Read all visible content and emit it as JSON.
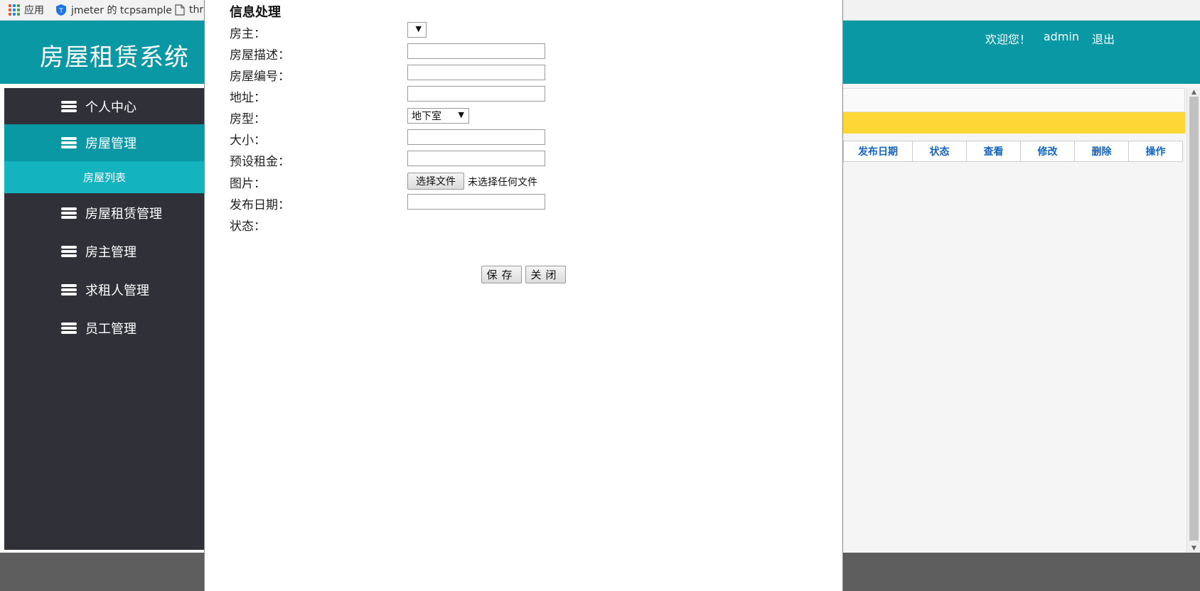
{
  "bookmarks": [
    {
      "label": "应用",
      "icon": "apps-icon"
    },
    {
      "label": "jmeter 的 tcpsample",
      "icon": "shield-icon"
    },
    {
      "label": "thr",
      "icon": "page-icon"
    }
  ],
  "header": {
    "title": "房屋租赁系统",
    "welcome": "欢迎您！",
    "username": "admin",
    "logout": "退出"
  },
  "sidebar": {
    "items": [
      {
        "label": "个人中心",
        "icon": "stack-icon"
      },
      {
        "label": "房屋管理",
        "icon": "stack-icon",
        "active": true
      },
      {
        "label": "房屋租赁管理",
        "icon": "stack-icon"
      },
      {
        "label": "房主管理",
        "icon": "stack-icon"
      },
      {
        "label": "求租人管理",
        "icon": "stack-icon"
      },
      {
        "label": "员工管理",
        "icon": "stack-icon"
      }
    ],
    "sub_item": "房屋列表"
  },
  "table": {
    "headers": [
      "发布日期",
      "状态",
      "查看",
      "修改",
      "删除",
      "操作"
    ]
  },
  "modal": {
    "title": "信息处理",
    "fields": {
      "landlord": "房主：",
      "description": "房屋描述：",
      "number": "房屋编号：",
      "address": "地址：",
      "type": "房型：",
      "size": "大小：",
      "rent": "预设租金：",
      "image": "图片：",
      "date": "发布日期：",
      "status": "状态："
    },
    "landlord_value": "",
    "type_value": "地下室",
    "file_button": "选择文件",
    "file_status": "未选择任何文件",
    "save": "保存",
    "close": "关闭"
  },
  "colors": {
    "header": "#0b98a5",
    "sidebar": "#2f3038",
    "active": "#0b98a5",
    "sub_active": "#13b3c0",
    "highlight": "#fdd835"
  }
}
